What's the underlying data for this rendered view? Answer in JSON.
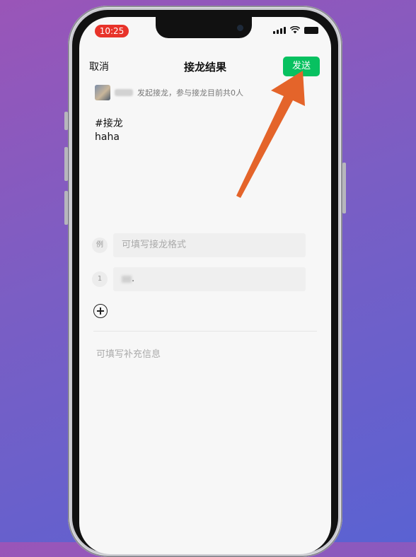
{
  "status_bar": {
    "time": "10:25"
  },
  "nav": {
    "cancel_label": "取消",
    "title": "接龙结果",
    "send_label": "发送"
  },
  "info": {
    "text": "发起接龙，参与接龙目前共0人"
  },
  "content": {
    "line1": "#接龙",
    "line2": "haha"
  },
  "format_row": {
    "badge": "例",
    "placeholder": "可填写接龙格式"
  },
  "entry_row": {
    "badge": "1",
    "value_suffix": "."
  },
  "supplement": {
    "placeholder": "可填写补充信息"
  },
  "colors": {
    "send_button": "#07c160",
    "arrow": "#e4642a",
    "time_pill": "#e8332a"
  },
  "icons": [
    "add-icon",
    "signal-icon",
    "wifi-icon",
    "battery-icon"
  ]
}
